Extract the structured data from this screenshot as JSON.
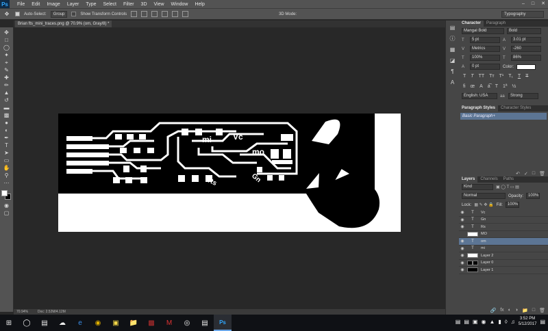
{
  "app": {
    "logo": "Ps"
  },
  "menu": [
    "File",
    "Edit",
    "Image",
    "Layer",
    "Type",
    "Select",
    "Filter",
    "3D",
    "View",
    "Window",
    "Help"
  ],
  "options": {
    "auto_select_label": "Auto-Select:",
    "auto_select_value": "Group",
    "transform_label": "Show Transform Controls",
    "mode_3d": "3D Mode:",
    "workspace": "Typography"
  },
  "document": {
    "tab_title": "Brian fts_mini_traces.png @ 70.9% (om, Gray/8) *",
    "zoom": "70.94%",
    "doc_size": "Doc: 2.52M/4.12M"
  },
  "artwork": {
    "labels": [
      "mi",
      "Vc",
      "mo",
      "Rs",
      "Gn"
    ]
  },
  "character_panel": {
    "tabs": [
      "Character",
      "Paragraph"
    ],
    "font_family": "Mangal Bold",
    "font_style": "Bold",
    "font_size": "5 pt",
    "leading": "3.01 pt",
    "kerning": "Metrics",
    "tracking": "-260",
    "vertical_scale": "100%",
    "horizontal_scale": "86%",
    "baseline_shift": "0 pt",
    "color_label": "Color:",
    "language": "English: USA",
    "antialias": "Strong"
  },
  "paragraph_styles_panel": {
    "tabs": [
      "Paragraph Styles",
      "Character Styles"
    ],
    "items": [
      "Basic Paragraph+"
    ]
  },
  "layers_panel": {
    "tabs": [
      "Layers",
      "Channels",
      "Paths"
    ],
    "filter": "Kind",
    "blend_mode": "Normal",
    "opacity_label": "Opacity:",
    "opacity": "100%",
    "lock_label": "Lock:",
    "fill_label": "Fill:",
    "fill": "100%",
    "layers": [
      {
        "name": "Vc",
        "type": "text",
        "visible": true,
        "selected": false
      },
      {
        "name": "Gn",
        "type": "text",
        "visible": true,
        "selected": false
      },
      {
        "name": "Rs",
        "type": "text",
        "visible": true,
        "selected": false
      },
      {
        "name": "MO",
        "type": "img",
        "visible": false,
        "selected": false
      },
      {
        "name": "om",
        "type": "text",
        "visible": true,
        "selected": true
      },
      {
        "name": "mi",
        "type": "text",
        "visible": true,
        "selected": false
      },
      {
        "name": "Layer 2",
        "type": "img",
        "visible": true,
        "selected": false
      },
      {
        "name": "Layer 0",
        "type": "mixed",
        "visible": true,
        "selected": false
      },
      {
        "name": "Layer 1",
        "type": "dark",
        "visible": true,
        "selected": false
      }
    ]
  },
  "taskbar": {
    "time": "3:52 PM",
    "date": "5/12/2017"
  }
}
